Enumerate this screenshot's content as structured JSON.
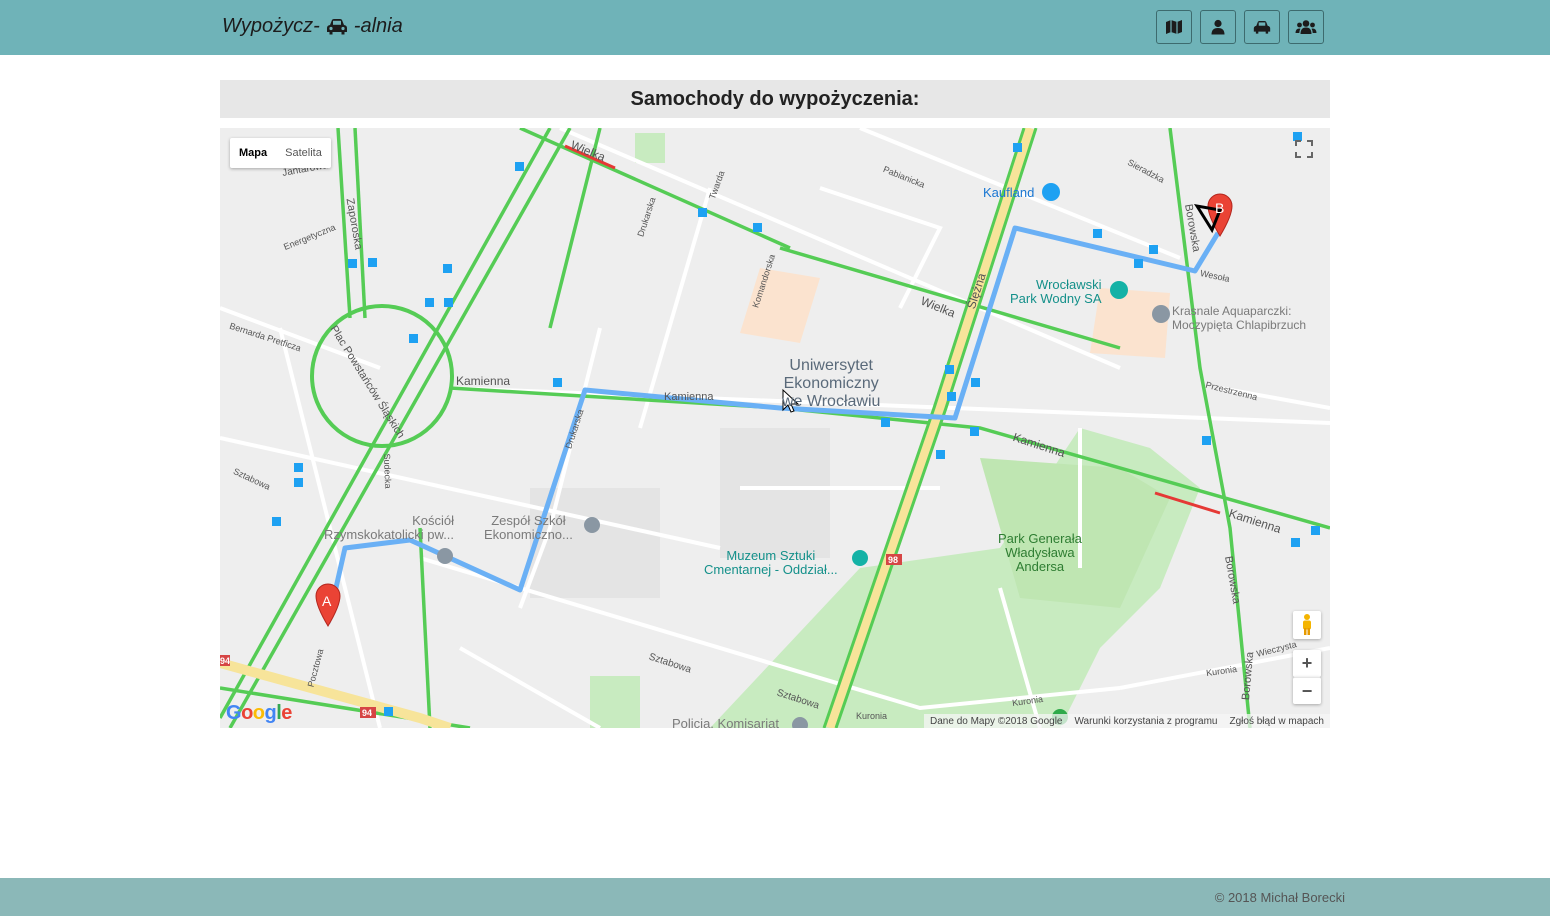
{
  "navbar": {
    "brand_prefix": "Wypożycz-",
    "brand_suffix": " -alnia",
    "brand_icon": "car-icon",
    "buttons": [
      {
        "icon": "map-icon"
      },
      {
        "icon": "user-icon"
      },
      {
        "icon": "car-icon"
      },
      {
        "icon": "users-icon"
      }
    ]
  },
  "main": {
    "title": "Samochody do wypożyczenia:"
  },
  "map": {
    "map_type": {
      "map": "Mapa",
      "satellite": "Satelita"
    },
    "markers": {
      "start": "A",
      "end": "B"
    },
    "streets": {
      "wielka": "Wielka",
      "wielka2": "Wielka",
      "jantarowa": "Jantarowa",
      "zaporoska": "Zaporoska",
      "energetyczna": "Energetyczna",
      "bernarda": "Bernarda Pretficza",
      "plac": "Plac Powstańców Śląskich",
      "kamienna1": "Kamienna",
      "kamienna2": "Kamienna",
      "kamienna3": "Kamienna",
      "kamienna4": "Kamienna",
      "sztabowa1": "Sztabowa",
      "sztabowa2": "Sztabowa",
      "sztabowa3": "Sztabowa",
      "sudecka": "Sudecka",
      "pocztowa": "Pocztowa",
      "drukarska1": "Drukarska",
      "drukarska2": "Drukarska",
      "twarda": "Twarda",
      "komandorska": "Komandorska",
      "pabianicka": "Pabianicka",
      "slezna": "Ślężna",
      "sieradzka": "Sieradzka",
      "borowska1": "Borowska",
      "borowska2": "Borowska",
      "borowska3": "Borowska",
      "wesola": "Wesoła",
      "przestrzenna": "Przestrzenna",
      "kuronia1": "Kuronia",
      "kuronia2": "Kuronia",
      "kuronia3": "Kuronia",
      "wieczysta": "Wieczysta"
    },
    "pois": {
      "kaufland": "Kaufland",
      "park_wodny": "Wrocławski\nPark Wodny SA",
      "aquaparczki": "Krasnale Aquaparczki:\nMoczypięta Chlapibrzuch",
      "uniwersytet": "Uniwersytet\nEkonomiczny\nwe Wrocławiu",
      "kosciol": "Kościół\nRzymskokatolicki pw...",
      "zespol": "Zespół Szkół\nEkonomiczno...",
      "muzeum": "Muzeum Sztuki\nCmentarnej - Oddział...",
      "park_andersa": "Park Generała\nWładysława\nAndersa",
      "policja": "Policja, Komisariat"
    },
    "road_numbers": {
      "r98": "98",
      "r94a": "94",
      "r94b": "94"
    },
    "zoom_in": "+",
    "zoom_out": "−",
    "google_logo": "Google",
    "attribution": {
      "data": "Dane do Mapy ©2018 Google",
      "terms": "Warunki korzystania z programu",
      "report": "Zgłoś błąd w mapach"
    }
  },
  "footer": {
    "copyright": "© 2018 Michał Borecki"
  },
  "colors": {
    "navbar": "#6fb3b8",
    "footer": "#8bb8b8",
    "route": "#6ab0f5",
    "traffic": "#55cc55",
    "marker": "#ea4335"
  }
}
